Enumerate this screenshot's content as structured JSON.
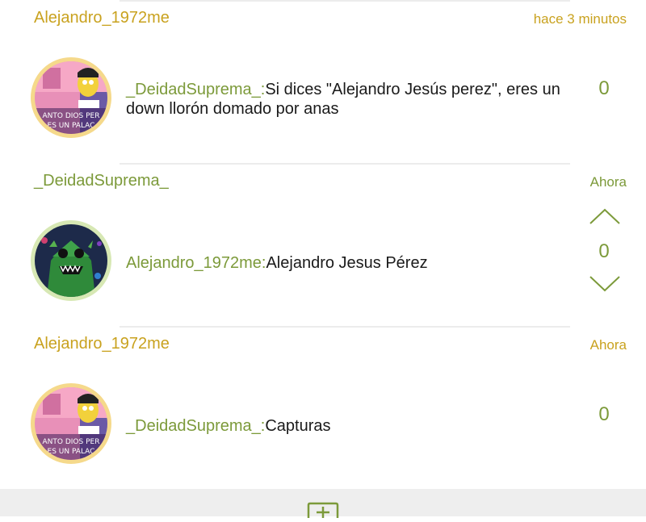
{
  "colors": {
    "gold": "#c9a21f",
    "green": "#7c9a3a",
    "text": "#1a1a1a"
  },
  "comments": [
    {
      "author": "Alejandro_1972me",
      "time": "hace 3 minutos",
      "avatar": "simpsons-character-avatar",
      "avatar_text_1": "ANTO DIOS PER",
      "avatar_text_2": "ES UN PALAC",
      "reply_to": "_DeidadSuprema_:",
      "body": "Si dices \"Alejandro Jesús perez\", eres un down llorón domado por anas",
      "votes": "0"
    },
    {
      "author": "_DeidadSuprema_",
      "time": "Ahora",
      "avatar": "green-dragon-avatar",
      "reply_to": "Alejandro_1972me:",
      "body": "Alejandro Jesus Pérez",
      "votes": "0"
    },
    {
      "author": "Alejandro_1972me",
      "time": "Ahora",
      "avatar": "simpsons-character-avatar",
      "avatar_text_1": "ANTO DIOS PER",
      "avatar_text_2": "ES UN PALAC",
      "reply_to": "_DeidadSuprema_:",
      "body": "Capturas",
      "votes": "0"
    }
  ],
  "bottom_bar": {
    "icon": "add-box-icon"
  }
}
